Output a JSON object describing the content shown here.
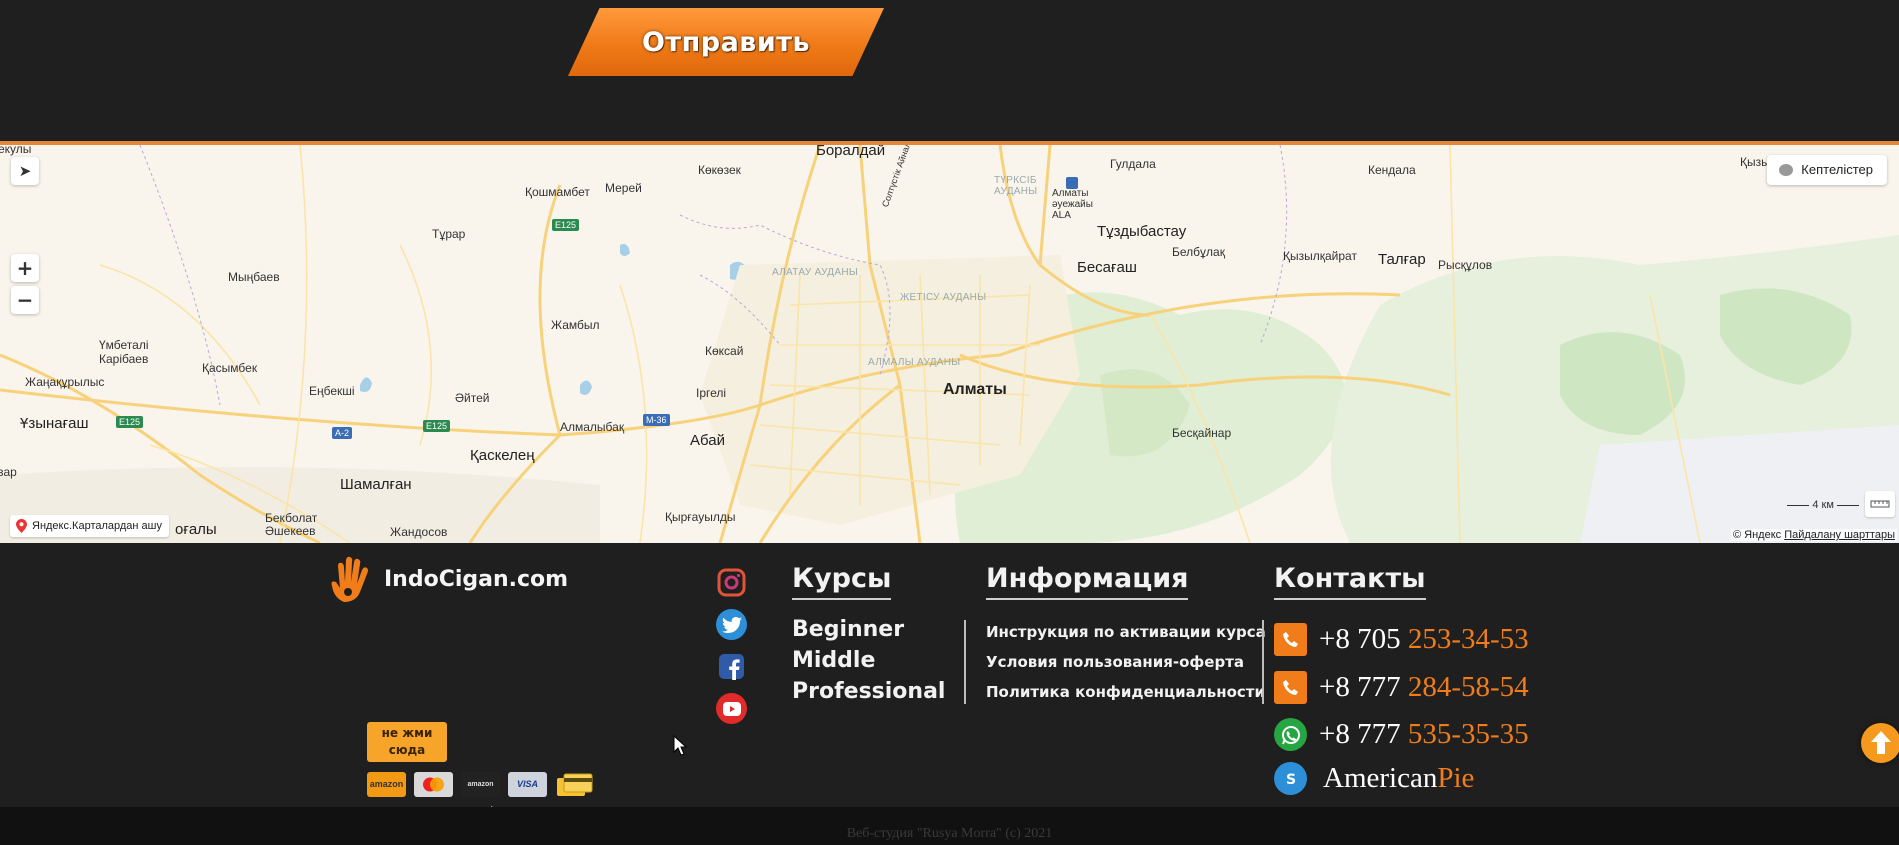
{
  "form": {
    "submit_label": "Отправить"
  },
  "map": {
    "layers_label": "Кептелістер",
    "open_in_yandex": "Яндекс.Карталардан ашу",
    "scale_label": "4 км",
    "copyright": "© Яндекс",
    "terms_link": "Пайдалану шарттары",
    "labels": {
      "boraldai": "Боралдай",
      "koshmambet": "Қошмамбет",
      "merei": "Мерей",
      "kokozek": "Көкөзек",
      "guldala": "Гулдала",
      "kendala": "Кендала",
      "kyzyl": "Қызыл",
      "turar": "Тұрар",
      "mynbaev": "Мыңбаев",
      "zhambyl": "Жамбыл",
      "kokzhai": "Көксай",
      "umbetali": "Үмбеталі",
      "karibaev": "Карібаев",
      "kasymbek": "Қасымбек",
      "zhanakurylys": "Жаңақұрылыс",
      "enbekshi": "Еңбекші",
      "aitei": "Әйтей",
      "uzynagash": "Ұзынағаш",
      "almalybak": "Алмалыбақ",
      "irgeli": "Іргелі",
      "abai": "Абай",
      "almaty": "Алматы",
      "kaskelen": "Қаскелең",
      "shamalgan": "Шамалған",
      "bekbolat": "Бекболат",
      "ashekeev": "Әшекеев",
      "zhandosov": "Жандосов",
      "kyrgauyldy": "Қырғауылды",
      "tuzdybastau": "Тұздыбастау",
      "besagash": "Бесағаш",
      "belbulak": "Белбұлақ",
      "kyzylkairat": "Қызылқайрат",
      "talgar": "Талғар",
      "ryskulov": "Рысқұлов",
      "beskainar": "Бесқайнар",
      "airport1": "Алматы",
      "airport2": "әуежайы",
      "airport3": "ALA",
      "edge_left1": "екулы",
      "edge_left2": "зар",
      "edge_left3": "оғалы",
      "alatau": "АЛАТАУ АУДАНЫ",
      "zhetysu": "ЖЕТІСУ АУДАНЫ",
      "almaly": "АЛМАЛЫ АУДАНЫ",
      "turksib1": "ТҮРКСІБ",
      "turksib2": "АУДАНЫ",
      "street": "Солтүстік Айналым көшесі",
      "e125a": "E125",
      "e125b": "E125",
      "e125c": "E125",
      "a2": "A-2",
      "m36": "M-36"
    }
  },
  "footer": {
    "brand": "IndoCigan.com",
    "pay_note": [
      "не жми",
      "сюда"
    ],
    "cards": [
      "amazon",
      "mastercard",
      "amazon payments",
      "VISA",
      "card"
    ],
    "courses_title": "Курсы",
    "courses": [
      "Beginner",
      "Middle",
      "Professional"
    ],
    "info_title": "Информация",
    "info": [
      "Инструкция по активации курса",
      "Условия пользования-оферта",
      "Политика конфиденциальности"
    ],
    "contacts_title": "Контакты",
    "contacts": [
      {
        "icon": "phone-icon",
        "prefix": "+8 705 ",
        "number": "253-34-53"
      },
      {
        "icon": "phone-icon",
        "prefix": "+8 777 ",
        "number": "284-58-54"
      },
      {
        "icon": "whatsapp-icon",
        "prefix": "+8 777 ",
        "number": "535-35-35"
      },
      {
        "icon": "skype-icon",
        "prefix": "American",
        "number": "Pie"
      }
    ],
    "copyright": "Веб-студия \"Rusya Morra\" (с) 2021"
  },
  "colors": {
    "accent": "#f07d1a",
    "background": "#1f1f1f",
    "map_bg": "#f9f5ec"
  }
}
